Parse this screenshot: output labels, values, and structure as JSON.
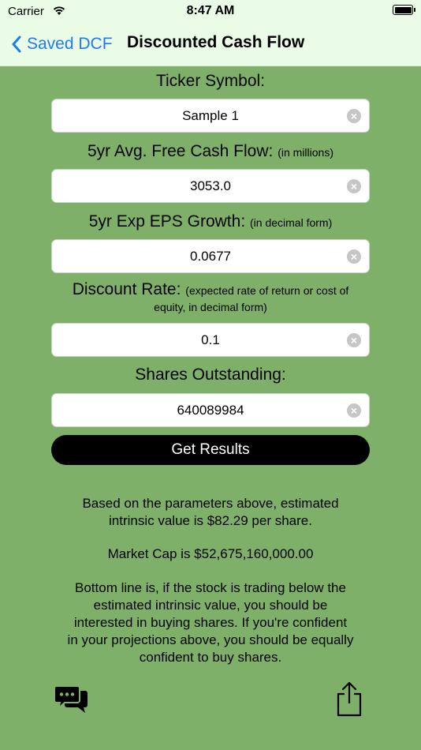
{
  "status_bar": {
    "carrier": "Carrier",
    "time": "8:47 AM"
  },
  "nav": {
    "back_label": "Saved DCF",
    "title": "Discounted Cash Flow"
  },
  "form": {
    "ticker_label": "Ticker Symbol:",
    "ticker_value": "Sample 1",
    "fcf_label": "5yr Avg. Free Cash Flow:",
    "fcf_note": "(in millions)",
    "fcf_value": "3053.0",
    "eps_label": "5yr Exp EPS Growth:",
    "eps_note": "(in decimal form)",
    "eps_value": "0.0677",
    "discount_label": "Discount Rate:",
    "discount_note_line1": "(expected rate of return or cost of",
    "discount_note_line2": "equity, in decimal form)",
    "discount_value": "0.1",
    "shares_label": "Shares Outstanding:",
    "shares_value": "640089984",
    "submit_label": "Get Results"
  },
  "results": {
    "intrinsic_line1": "Based on the parameters above, estimated",
    "intrinsic_line2": "intrinsic value is $82.29 per share.",
    "market_cap": "Market Cap is $52,675,160,000.00",
    "bottom_line_1": "Bottom line is, if the stock is trading below the",
    "bottom_line_2": "estimated intrinsic value, you should be",
    "bottom_line_3": "interested in buying shares. If you're confident",
    "bottom_line_4": "in your projections above, you should be equally",
    "bottom_line_5": "confident to buy shares."
  },
  "icons": {
    "clear": "clear-icon",
    "chat": "chat-bubbles-icon",
    "share": "share-icon",
    "back": "chevron-left-icon"
  },
  "colors": {
    "background": "#7fb06a",
    "nav_background": "#eafbe6",
    "accent": "#1e7cf2",
    "button": "#000000"
  }
}
